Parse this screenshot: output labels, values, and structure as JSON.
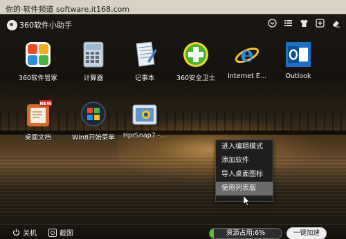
{
  "watermark": "你的·软件频道 software.it168.com",
  "window": {
    "title": "360软件小助手",
    "toolbar_icons": [
      "chevron-down-circle-icon",
      "list-icon",
      "tshirt-icon",
      "add-icon",
      "eraser-icon"
    ]
  },
  "apps": [
    {
      "label": "360软件管家",
      "icon": "software-manager-icon"
    },
    {
      "label": "计算器",
      "icon": "calculator-icon"
    },
    {
      "label": "记事本",
      "icon": "notepad-icon"
    },
    {
      "label": "360安全卫士",
      "icon": "360-safeguard-icon"
    },
    {
      "label": "Internet E...",
      "icon": "internet-explorer-icon"
    },
    {
      "label": "Outlook",
      "icon": "outlook-icon"
    },
    {
      "label": "桌面文档",
      "icon": "desktop-docs-icon",
      "badge": "NEW"
    },
    {
      "label": "Win8开始菜单",
      "icon": "win8-start-menu-icon"
    },
    {
      "label": "HprSnap7 -...",
      "icon": "hypersnap-icon"
    }
  ],
  "context_menu": {
    "items": [
      "进入编辑模式",
      "添加软件",
      "导入桌面图标",
      "使用列表版"
    ],
    "highlighted_index": 3
  },
  "bottom": {
    "shutdown_label": "关机",
    "screenshot_label": "截图",
    "resource_usage_label": "资源占用:6%",
    "resource_usage_percent": 6,
    "accelerate_label": "一键加速"
  }
}
